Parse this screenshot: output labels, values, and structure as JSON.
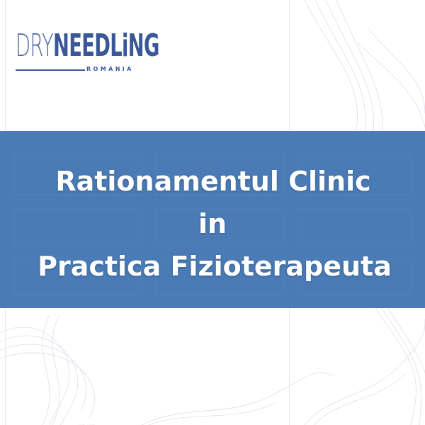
{
  "logo": {
    "dry": "DRY",
    "needling": "NEEDLiNG",
    "sub": "ROMANIA"
  },
  "title": {
    "line1": "Rationamentul Clinic",
    "line2": "in",
    "line3": "Practica Fizioterapeuta"
  },
  "colors": {
    "banner": "#4a7bb6",
    "logo": "#3a5797",
    "background": "#ffffff"
  },
  "icons": [
    "logo-wordmark",
    "background-waves"
  ]
}
